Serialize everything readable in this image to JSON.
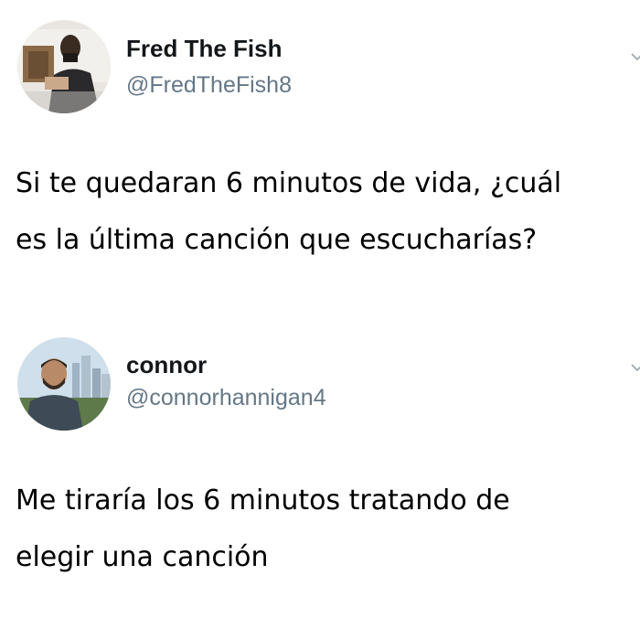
{
  "tweets": [
    {
      "author": {
        "display_name": "Fred The Fish",
        "handle": "@FredTheFish8",
        "avatar_icon": "profile-photo-mirror-selfie"
      },
      "text_lines": [
        "Si te quedaran 6 minutos de vida, ¿cuál",
        "es la última canción que escucharías?"
      ]
    },
    {
      "author": {
        "display_name": "connor",
        "handle": "@connorhannigan4",
        "avatar_icon": "profile-photo-man-city-skyline"
      },
      "text_lines": [
        "Me tiraría los 6 minutos tratando de",
        "elegir una canción"
      ]
    }
  ],
  "colors": {
    "background": "#ffffff",
    "name": "#14171a",
    "handle": "#657786",
    "text": "#000000"
  }
}
